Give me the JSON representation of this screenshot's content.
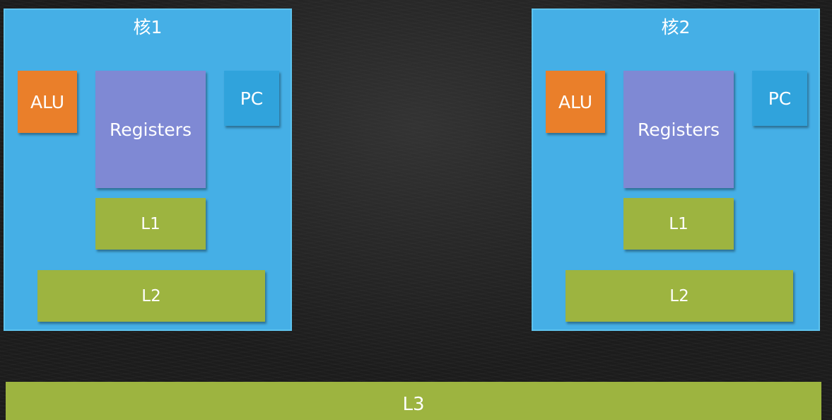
{
  "colors": {
    "background": "#1c1c1c",
    "core": "#45afe6",
    "alu": "#ea7f2a",
    "registers": "#7f89d4",
    "pc": "#30a3dc",
    "cache": "#9db440",
    "text": "#ffffff"
  },
  "cores": [
    {
      "title": "核1",
      "alu": "ALU",
      "registers": "Registers",
      "pc": "PC",
      "l1": "L1",
      "l2": "L2"
    },
    {
      "title": "核2",
      "alu": "ALU",
      "registers": "Registers",
      "pc": "PC",
      "l1": "L1",
      "l2": "L2"
    }
  ],
  "shared": {
    "l3": "L3"
  }
}
